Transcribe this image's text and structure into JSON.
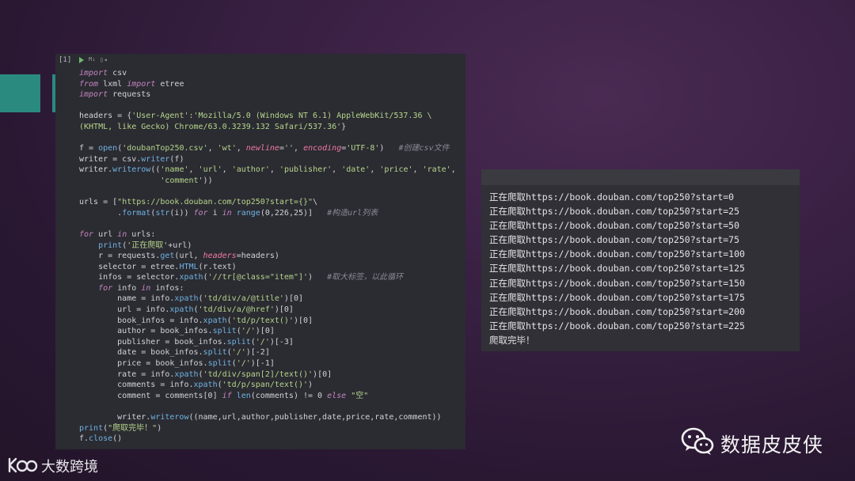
{
  "cell": {
    "exec_count": "[1]",
    "md_label": "M↓",
    "split_label": "▯◂",
    "code_lines": [
      [
        [
          "kw",
          "import"
        ],
        [
          "nm",
          " csv"
        ]
      ],
      [
        [
          "kw",
          "from"
        ],
        [
          "nm",
          " lxml "
        ],
        [
          "kw",
          "import"
        ],
        [
          "nm",
          " etree"
        ]
      ],
      [
        [
          "kw",
          "import"
        ],
        [
          "nm",
          " requests"
        ]
      ],
      [],
      [
        [
          "nm",
          "headers = {"
        ],
        [
          "st",
          "'User-Agent':'Mozilla/5.0 (Windows NT 6.1) AppleWebKit/537.36 \\"
        ]
      ],
      [
        [
          "st",
          "(KHTML, like Gecko) Chrome/63.0.3239.132 Safari/537.36'"
        ],
        [
          "nm",
          "}"
        ]
      ],
      [],
      [
        [
          "nm",
          "f = "
        ],
        [
          "fn",
          "open"
        ],
        [
          "nm",
          "("
        ],
        [
          "st",
          "'doubanTop250.csv'"
        ],
        [
          "nm",
          ", "
        ],
        [
          "st",
          "'wt'"
        ],
        [
          "nm",
          ", "
        ],
        [
          "pm",
          "newline"
        ],
        [
          "nm",
          "="
        ],
        [
          "st",
          "''"
        ],
        [
          "nm",
          ", "
        ],
        [
          "pm",
          "encoding"
        ],
        [
          "nm",
          "="
        ],
        [
          "st",
          "'UTF-8'"
        ],
        [
          "nm",
          ")   "
        ],
        [
          "cm",
          "#创建csv文件"
        ]
      ],
      [
        [
          "nm",
          "writer = csv."
        ],
        [
          "fn",
          "writer"
        ],
        [
          "nm",
          "(f)"
        ]
      ],
      [
        [
          "nm",
          "writer."
        ],
        [
          "fn",
          "writerow"
        ],
        [
          "nm",
          "(("
        ],
        [
          "st",
          "'name'"
        ],
        [
          "nm",
          ", "
        ],
        [
          "st",
          "'url'"
        ],
        [
          "nm",
          ", "
        ],
        [
          "st",
          "'author'"
        ],
        [
          "nm",
          ", "
        ],
        [
          "st",
          "'publisher'"
        ],
        [
          "nm",
          ", "
        ],
        [
          "st",
          "'date'"
        ],
        [
          "nm",
          ", "
        ],
        [
          "st",
          "'price'"
        ],
        [
          "nm",
          ", "
        ],
        [
          "st",
          "'rate'"
        ],
        [
          "nm",
          ","
        ]
      ],
      [
        [
          "nm",
          "                 "
        ],
        [
          "st",
          "'comment'"
        ],
        [
          "nm",
          "))"
        ]
      ],
      [],
      [
        [
          "nm",
          "urls = ["
        ],
        [
          "st",
          "\"https://book.douban.com/top250?start={}\""
        ],
        [
          "nm",
          "\\"
        ]
      ],
      [
        [
          "nm",
          "        ."
        ],
        [
          "fn",
          "format"
        ],
        [
          "nm",
          "("
        ],
        [
          "fn",
          "str"
        ],
        [
          "nm",
          "(i)) "
        ],
        [
          "kw",
          "for"
        ],
        [
          "nm",
          " i "
        ],
        [
          "kw",
          "in"
        ],
        [
          "nm",
          " "
        ],
        [
          "fn",
          "range"
        ],
        [
          "nm",
          "(0,226,25)]   "
        ],
        [
          "cm",
          "#构造url列表"
        ]
      ],
      [],
      [
        [
          "kw",
          "for"
        ],
        [
          "nm",
          " url "
        ],
        [
          "kw",
          "in"
        ],
        [
          "nm",
          " urls:"
        ]
      ],
      [
        [
          "nm",
          "    "
        ],
        [
          "fn",
          "print"
        ],
        [
          "nm",
          "("
        ],
        [
          "st",
          "'正在爬取'"
        ],
        [
          "nm",
          "+url)"
        ]
      ],
      [
        [
          "nm",
          "    r = requests."
        ],
        [
          "fn",
          "get"
        ],
        [
          "nm",
          "(url, "
        ],
        [
          "pm",
          "headers"
        ],
        [
          "nm",
          "=headers)"
        ]
      ],
      [
        [
          "nm",
          "    selector = etree."
        ],
        [
          "fn",
          "HTML"
        ],
        [
          "nm",
          "(r.text)"
        ]
      ],
      [
        [
          "nm",
          "    infos = selector."
        ],
        [
          "fn",
          "xpath"
        ],
        [
          "nm",
          "("
        ],
        [
          "st",
          "'//tr[@class=\"item\"]'"
        ],
        [
          "nm",
          ")   "
        ],
        [
          "cm",
          "#取大标签，以此循环"
        ]
      ],
      [
        [
          "nm",
          "    "
        ],
        [
          "kw",
          "for"
        ],
        [
          "nm",
          " info "
        ],
        [
          "kw",
          "in"
        ],
        [
          "nm",
          " infos:"
        ]
      ],
      [
        [
          "nm",
          "        name = info."
        ],
        [
          "fn",
          "xpath"
        ],
        [
          "nm",
          "("
        ],
        [
          "st",
          "'td/div/a/@title'"
        ],
        [
          "nm",
          ")[0]"
        ]
      ],
      [
        [
          "nm",
          "        url = info."
        ],
        [
          "fn",
          "xpath"
        ],
        [
          "nm",
          "("
        ],
        [
          "st",
          "'td/div/a/@href'"
        ],
        [
          "nm",
          ")[0]"
        ]
      ],
      [
        [
          "nm",
          "        book_infos = info."
        ],
        [
          "fn",
          "xpath"
        ],
        [
          "nm",
          "("
        ],
        [
          "st",
          "'td/p/text()'"
        ],
        [
          "nm",
          ")[0]"
        ]
      ],
      [
        [
          "nm",
          "        author = book_infos."
        ],
        [
          "fn",
          "split"
        ],
        [
          "nm",
          "("
        ],
        [
          "st",
          "'/'"
        ],
        [
          "nm",
          ")[0]"
        ]
      ],
      [
        [
          "nm",
          "        publisher = book_infos."
        ],
        [
          "fn",
          "split"
        ],
        [
          "nm",
          "("
        ],
        [
          "st",
          "'/'"
        ],
        [
          "nm",
          ")[-3]"
        ]
      ],
      [
        [
          "nm",
          "        date = book_infos."
        ],
        [
          "fn",
          "split"
        ],
        [
          "nm",
          "("
        ],
        [
          "st",
          "'/'"
        ],
        [
          "nm",
          ")[-2]"
        ]
      ],
      [
        [
          "nm",
          "        price = book_infos."
        ],
        [
          "fn",
          "split"
        ],
        [
          "nm",
          "("
        ],
        [
          "st",
          "'/'"
        ],
        [
          "nm",
          ")[-1]"
        ]
      ],
      [
        [
          "nm",
          "        rate = info."
        ],
        [
          "fn",
          "xpath"
        ],
        [
          "nm",
          "("
        ],
        [
          "st",
          "'td/div/span[2]/text()'"
        ],
        [
          "nm",
          ")[0]"
        ]
      ],
      [
        [
          "nm",
          "        comments = info."
        ],
        [
          "fn",
          "xpath"
        ],
        [
          "nm",
          "("
        ],
        [
          "st",
          "'td/p/span/text()'"
        ],
        [
          "nm",
          ")"
        ]
      ],
      [
        [
          "nm",
          "        comment = comments[0] "
        ],
        [
          "kw",
          "if"
        ],
        [
          "nm",
          " "
        ],
        [
          "fn",
          "len"
        ],
        [
          "nm",
          "(comments) != 0 "
        ],
        [
          "kw",
          "else"
        ],
        [
          "nm",
          " "
        ],
        [
          "st",
          "\"空\""
        ]
      ],
      [],
      [
        [
          "nm",
          "        writer."
        ],
        [
          "fn",
          "writerow"
        ],
        [
          "nm",
          "((name,url,author,publisher,date,price,rate,comment))"
        ]
      ],
      [
        [
          "fn",
          "print"
        ],
        [
          "nm",
          "("
        ],
        [
          "st",
          "\"爬取完毕！\""
        ],
        [
          "nm",
          ")"
        ]
      ],
      [
        [
          "nm",
          "f."
        ],
        [
          "fn",
          "close"
        ],
        [
          "nm",
          "()"
        ]
      ]
    ]
  },
  "output": {
    "lines": [
      "正在爬取https://book.douban.com/top250?start=0",
      "正在爬取https://book.douban.com/top250?start=25",
      "正在爬取https://book.douban.com/top250?start=50",
      "正在爬取https://book.douban.com/top250?start=75",
      "正在爬取https://book.douban.com/top250?start=100",
      "正在爬取https://book.douban.com/top250?start=125",
      "正在爬取https://book.douban.com/top250?start=150",
      "正在爬取https://book.douban.com/top250?start=175",
      "正在爬取https://book.douban.com/top250?start=200",
      "正在爬取https://book.douban.com/top250?start=225",
      "爬取完毕！"
    ]
  },
  "watermark": {
    "name": "数据皮皮侠",
    "icon": "wechat-icon"
  },
  "brand": {
    "text": "大数跨境",
    "icon": "brand-logo-icon"
  },
  "colors": {
    "background": "#2e1b38",
    "accent_teal": "#2a8a80",
    "cell_bg": "#2b2b32",
    "output_bg": "#303036"
  }
}
